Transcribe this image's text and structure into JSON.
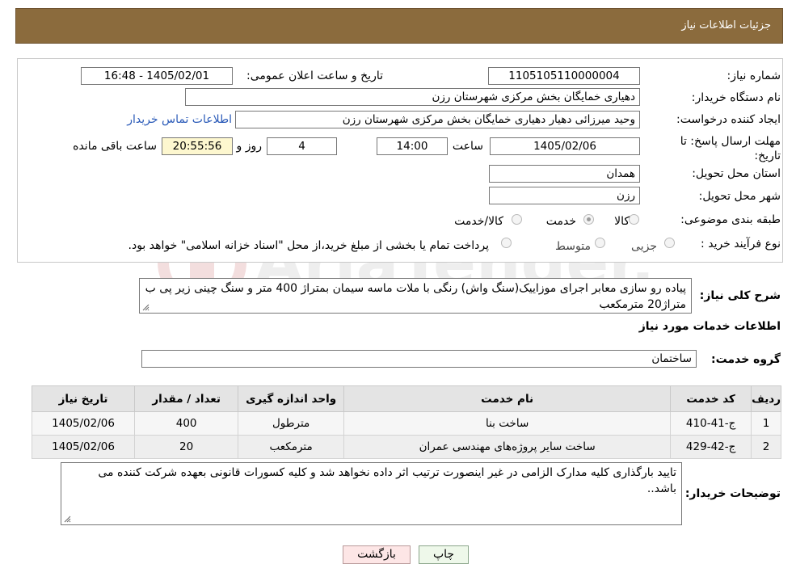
{
  "header": {
    "title": "جزئیات اطلاعات نیاز"
  },
  "form": {
    "need_number": {
      "label": "شماره نیاز:",
      "value": "1105105110000004"
    },
    "announce_datetime": {
      "label": "تاریخ و ساعت اعلان عمومی:",
      "value": "1405/02/01 - 16:48"
    },
    "buyer_org": {
      "label": "نام دستگاه خریدار:",
      "value": "دهیاری خمایگان بخش مرکزی شهرستان رزن"
    },
    "requester": {
      "label": "ایجاد کننده درخواست:",
      "value": "وحید میرزائی دهیار دهیاری خمایگان بخش مرکزی شهرستان رزن",
      "contact_link": "اطلاعات تماس خریدار"
    },
    "deadline": {
      "label": "مهلت ارسال پاسخ: تا تاریخ:",
      "date": "1405/02/06",
      "time_label": "ساعت",
      "time": "14:00",
      "days": "4",
      "days_label": "روز و",
      "remaining": "20:55:56",
      "remaining_label": "ساعت باقی مانده"
    },
    "province": {
      "label": "استان محل تحویل:",
      "value": "همدان"
    },
    "city": {
      "label": "شهر محل تحویل:",
      "value": "رزن"
    },
    "category": {
      "label": "طبقه بندی موضوعی:",
      "options": [
        "کالا",
        "خدمت",
        "کالا/خدمت"
      ],
      "selected": "خدمت"
    },
    "purchase_type": {
      "label": "نوع فرآیند خرید :",
      "options": [
        "جزیی",
        "متوسط"
      ],
      "selected": "",
      "note": "پرداخت تمام یا بخشی از مبلغ خرید،از محل \"اسناد خزانه اسلامی\" خواهد بود."
    }
  },
  "description": {
    "label": "شرح کلی نیاز:",
    "value": "پیاده رو سازی معابر اجرای موزاییک(سنگ واش) رنگی با ملات ماسه سیمان بمتراژ 400 متر و سنگ چینی زیر پی ب متراژ20 مترمکعب"
  },
  "services": {
    "section_title": "اطلاعات خدمات مورد نیاز",
    "group_label": "گروه خدمت:",
    "group_value": "ساختمان",
    "table": {
      "headers": [
        "ردیف",
        "کد خدمت",
        "نام خدمت",
        "واحد اندازه گیری",
        "تعداد / مقدار",
        "تاریخ نیاز"
      ],
      "rows": [
        [
          "1",
          "ج-41-410",
          "ساخت بنا",
          "مترطول",
          "400",
          "1405/02/06"
        ],
        [
          "2",
          "ج-42-429",
          "ساخت سایر پروژه‌های مهندسی عمران",
          "مترمکعب",
          "20",
          "1405/02/06"
        ]
      ]
    }
  },
  "buyer_notes": {
    "label": "توضیحات خریدار:",
    "value": "تایید بارگذاری کلیه مدارک الزامی در غیر اینصورت ترتیب اثر داده نخواهد شد و کلیه کسورات قانونی بعهده شرکت کننده می باشد.."
  },
  "buttons": {
    "print": "چاپ",
    "back": "بازگشت"
  },
  "watermark": {
    "text": "AriaTender.neT"
  },
  "colors": {
    "header": "#8b6b3d",
    "link": "#2a5ab8",
    "highlight": "#fdf7cf",
    "back_button": "#fde6e6",
    "print_button": "#eef8ea"
  }
}
